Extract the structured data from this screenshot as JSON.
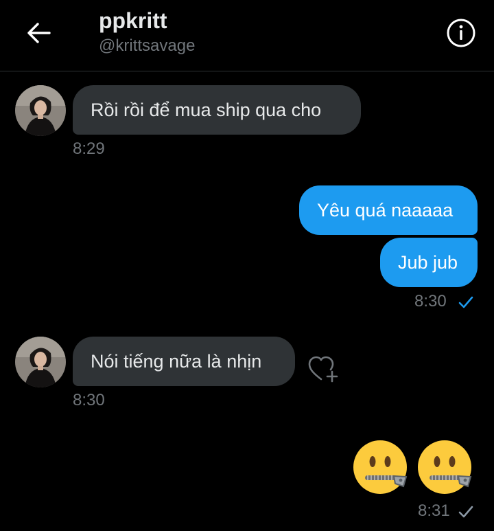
{
  "header": {
    "title": "ppkritt",
    "handle": "@krittsavage"
  },
  "icons": {
    "back": "arrow-left-icon",
    "info": "info-circle-icon",
    "like": "heart-plus-icon",
    "read": "checkmark-icon",
    "emoji": "zipper-mouth-face-icon"
  },
  "colors": {
    "background": "#000000",
    "outgoing_bubble": "#1d9bf0",
    "incoming_bubble": "#2f3336",
    "muted_text": "#71767b",
    "accent_check": "#1d9bf0",
    "read_check": "#8b98a5"
  },
  "messages": [
    {
      "direction": "incoming",
      "text": "Rồi rồi để mua ship qua cho",
      "time": "8:29"
    },
    {
      "direction": "outgoing",
      "text": "Yêu quá naaaaa"
    },
    {
      "direction": "outgoing",
      "text": "Jub jub",
      "time": "8:30"
    },
    {
      "direction": "incoming",
      "text": "Nói tiếng nữa là nhịn",
      "time": "8:30"
    },
    {
      "direction": "outgoing",
      "emoji": "🤐🤐",
      "time": "8:31"
    }
  ]
}
